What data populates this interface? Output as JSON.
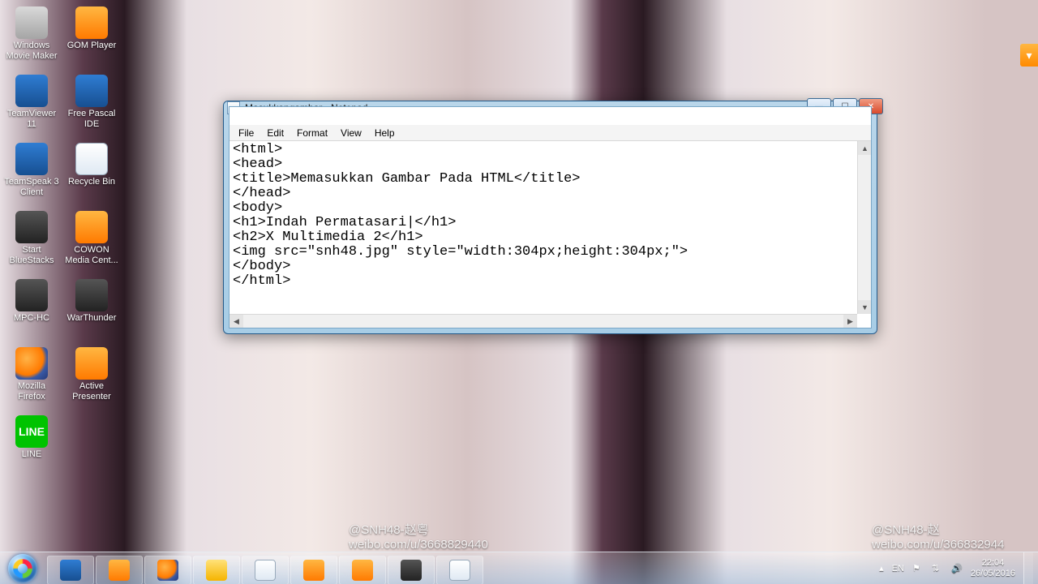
{
  "desktop_icons_col1": [
    {
      "label": "Windows Movie Maker",
      "cls": "ic-grey"
    },
    {
      "label": "TeamViewer 11",
      "cls": "ic-blue"
    },
    {
      "label": "TeamSpeak 3 Client",
      "cls": "ic-blue"
    },
    {
      "label": "Start BlueStacks",
      "cls": "ic-dark"
    },
    {
      "label": "MPC-HC",
      "cls": "ic-dark"
    },
    {
      "label": "Mozilla Firefox",
      "cls": "ic-ff"
    },
    {
      "label": "LINE",
      "cls": "ic-line",
      "txt": "LINE"
    }
  ],
  "desktop_icons_col2": [
    {
      "label": "GOM Player",
      "cls": "ic-orange"
    },
    {
      "label": "Free Pascal IDE",
      "cls": "ic-blue"
    },
    {
      "label": "Recycle Bin",
      "cls": "ic-white"
    },
    {
      "label": "COWON Media Cent...",
      "cls": "ic-orange"
    },
    {
      "label": "WarThunder",
      "cls": "ic-dark"
    },
    {
      "label": "Active Presenter",
      "cls": "ic-orange"
    }
  ],
  "watermark1": "@SNH48-赵粤\nweibo.com/u/3668829440",
  "watermark2": "@SNH48-赵\nweibo.com/u/366832944",
  "window": {
    "title": "Masukkangambar - Notepad",
    "menus": [
      "File",
      "Edit",
      "Format",
      "View",
      "Help"
    ],
    "content": "<html>\n<head>\n<title>Memasukkan Gambar Pada HTML</title>\n</head>\n<body>\n<h1>Indah Permatasari|</h1>\n<h2>X Multimedia 2</h1>\n<img src=\"snh48.jpg\" style=\"width:304px;height:304px;\">\n</body>\n</html>"
  },
  "taskbar_items": [
    {
      "name": "ie",
      "cls": "ic-blue"
    },
    {
      "name": "wmp",
      "cls": "ic-orange"
    },
    {
      "name": "firefox",
      "cls": "ic-ff"
    },
    {
      "name": "explorer",
      "cls": "ic-yellow"
    },
    {
      "name": "app1",
      "cls": "ic-white"
    },
    {
      "name": "app2",
      "cls": "ic-orange"
    },
    {
      "name": "app3",
      "cls": "ic-orange"
    },
    {
      "name": "app4",
      "cls": "ic-dark"
    },
    {
      "name": "notepad",
      "cls": "ic-white"
    }
  ],
  "tray": {
    "lang": "EN",
    "time": "22:04",
    "date": "26/05/2016"
  }
}
